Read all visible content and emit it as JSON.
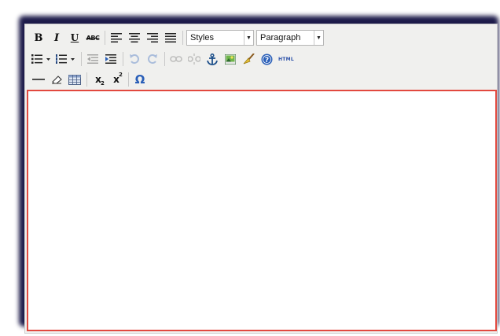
{
  "toolbar": {
    "bold_label": "B",
    "italic_label": "I",
    "underline_label": "U",
    "strike_label": "ABC",
    "styles_select": "Styles",
    "format_select": "Paragraph",
    "html_label": "HTML",
    "sub_main": "x",
    "sub_small": "2",
    "sup_main": "x",
    "sup_small": "2",
    "charmap_label": "Ω"
  },
  "icons": [
    "align-left-icon",
    "align-center-icon",
    "align-right-icon",
    "align-justify-icon",
    "bullet-list-icon",
    "numbered-list-icon",
    "outdent-icon",
    "indent-icon",
    "undo-icon",
    "redo-icon",
    "link-icon",
    "unlink-icon",
    "anchor-icon",
    "image-icon",
    "cleanup-icon",
    "help-icon",
    "hr-icon",
    "eraser-icon",
    "table-icon"
  ],
  "colors": {
    "content_border": "#e2493f",
    "toolbar_bg": "#f0f0ee",
    "shadow": "#1d1b4a"
  }
}
